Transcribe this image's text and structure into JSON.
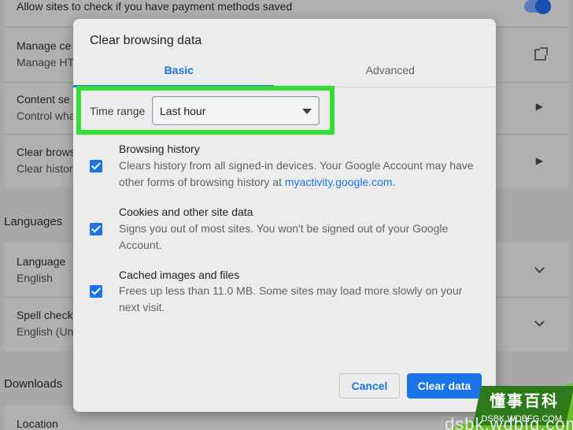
{
  "background": {
    "rows": [
      {
        "title": "Allow sites to check if you have payment methods saved",
        "subtitle": ""
      },
      {
        "title": "Manage ce",
        "subtitle": "Manage HT"
      },
      {
        "title": "Content se",
        "subtitle": "Control wha"
      },
      {
        "title": "Clear brows",
        "subtitle": "Clear histor"
      }
    ],
    "languages_heading": "Languages",
    "language_rows": [
      {
        "title": "Language",
        "subtitle": "English"
      },
      {
        "title": "Spell check",
        "subtitle": "English (Un"
      }
    ],
    "downloads_heading": "Downloads",
    "downloads_rows": [
      {
        "title": "Location",
        "subtitle": ""
      }
    ]
  },
  "dialog": {
    "title": "Clear browsing data",
    "tabs": [
      {
        "label": "Basic",
        "active": true
      },
      {
        "label": "Advanced",
        "active": false
      }
    ],
    "time_range": {
      "label": "Time range",
      "value": "Last hour"
    },
    "options": [
      {
        "title": "Browsing history",
        "desc_before_link": "Clears history from all signed-in devices. Your Google Account may have other forms of browsing history at ",
        "link": "myactivity.google.com",
        "desc_after_link": ".",
        "checked": true
      },
      {
        "title": "Cookies and other site data",
        "desc": "Signs you out of most sites. You won't be signed out of your Google Account.",
        "checked": true
      },
      {
        "title": "Cached images and files",
        "desc": "Frees up less than 11.0 MB. Some sites may load more slowly on your next visit.",
        "checked": true
      }
    ],
    "cancel_label": "Cancel",
    "clear_label": "Clear data"
  },
  "watermark": {
    "cn_text": "懂事百科",
    "url_text": "DSBK.WDBFG.COM",
    "bottom_text": "dsbk.wdbfg.com"
  },
  "colors": {
    "accent": "#1a73e8",
    "highlight": "#32e032"
  }
}
